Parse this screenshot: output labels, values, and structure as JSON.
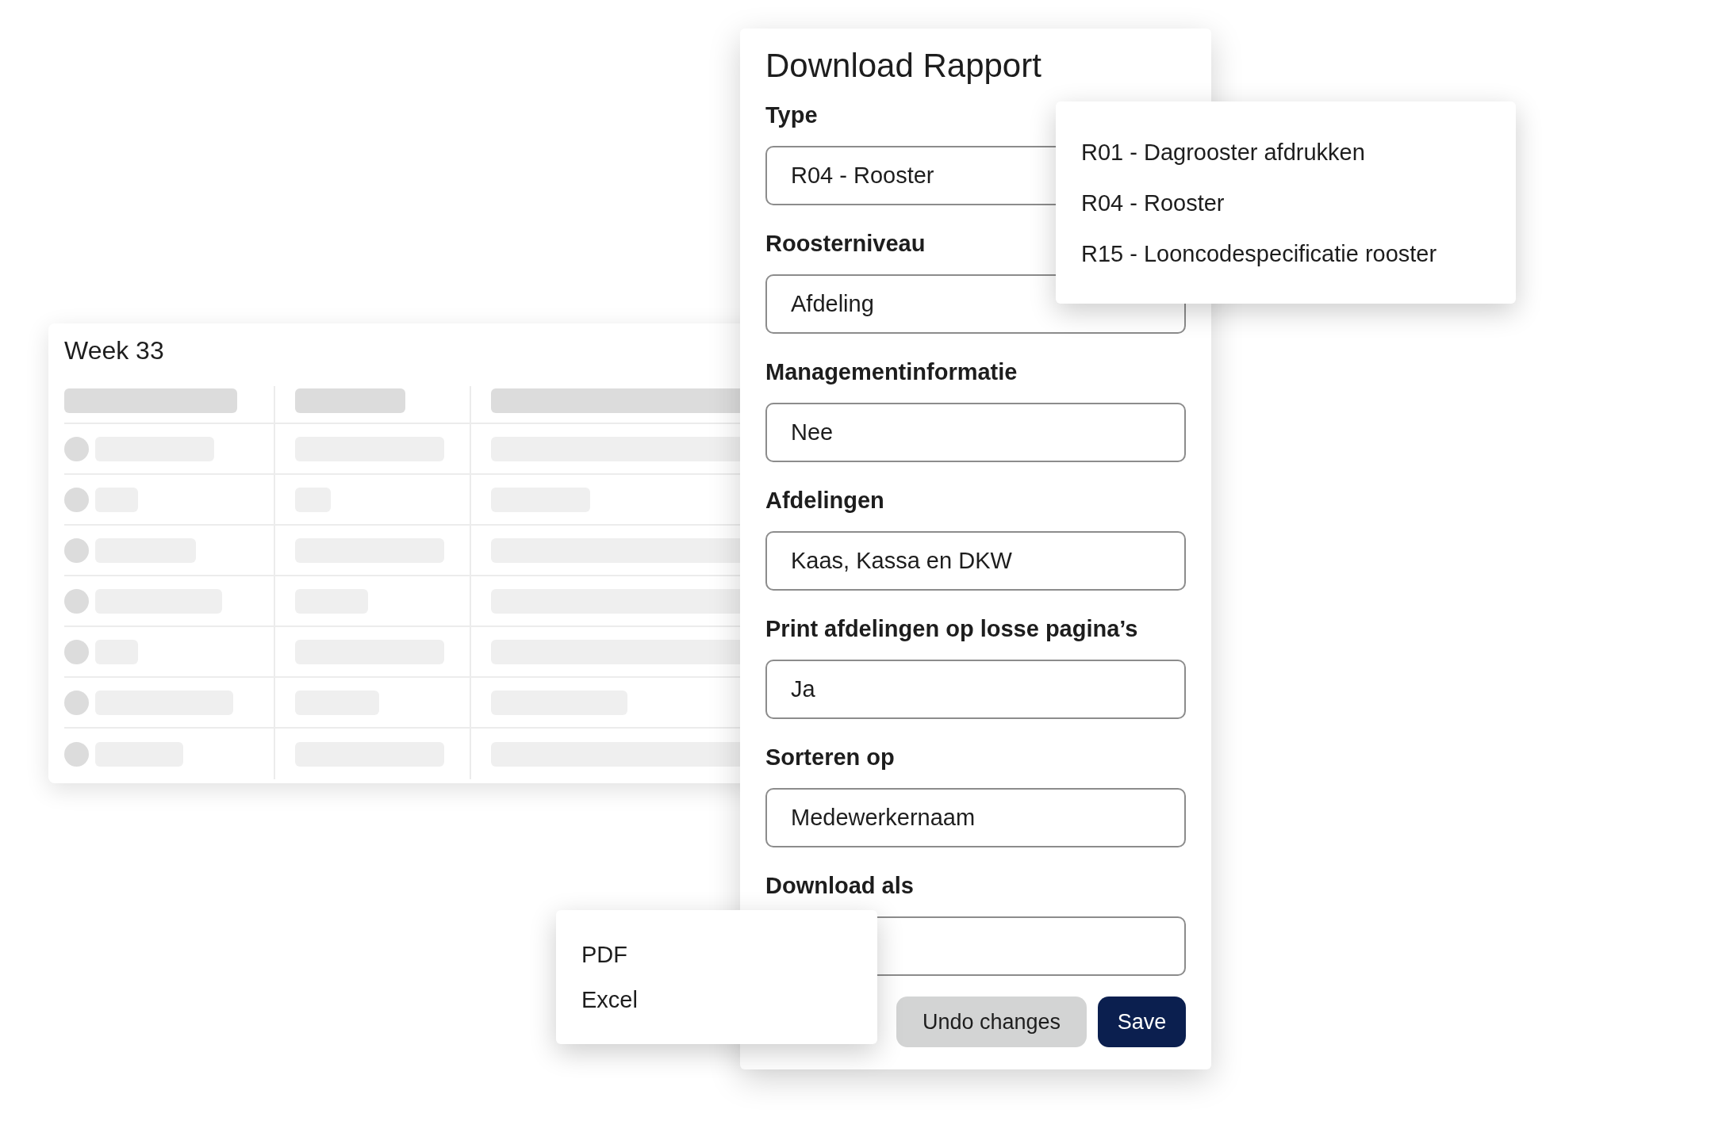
{
  "week_table": {
    "title": "Week 33"
  },
  "dialog": {
    "title": "Download Rapport",
    "fields": [
      {
        "label": "Type",
        "value": "R04 - Rooster"
      },
      {
        "label": "Roosterniveau",
        "value": "Afdeling"
      },
      {
        "label": "Managementinformatie",
        "value": "Nee"
      },
      {
        "label": "Afdelingen",
        "value": "Kaas, Kassa en DKW"
      },
      {
        "label": "Print afdelingen op losse pagina’s",
        "value": "Ja"
      },
      {
        "label": "Sorteren op",
        "value": "Medewerkernaam"
      },
      {
        "label": "Download als"
      }
    ],
    "buttons": [
      {
        "label": "Undo changes",
        "kind": "secondary"
      },
      {
        "label": "Save",
        "kind": "primary"
      }
    ]
  },
  "type_menu": {
    "options": [
      "R01 - Dagrooster afdrukken",
      "R04 - Rooster",
      "R15 - Looncodespecificatie rooster"
    ]
  },
  "download_menu": {
    "options": [
      "PDF",
      "Excel"
    ]
  }
}
